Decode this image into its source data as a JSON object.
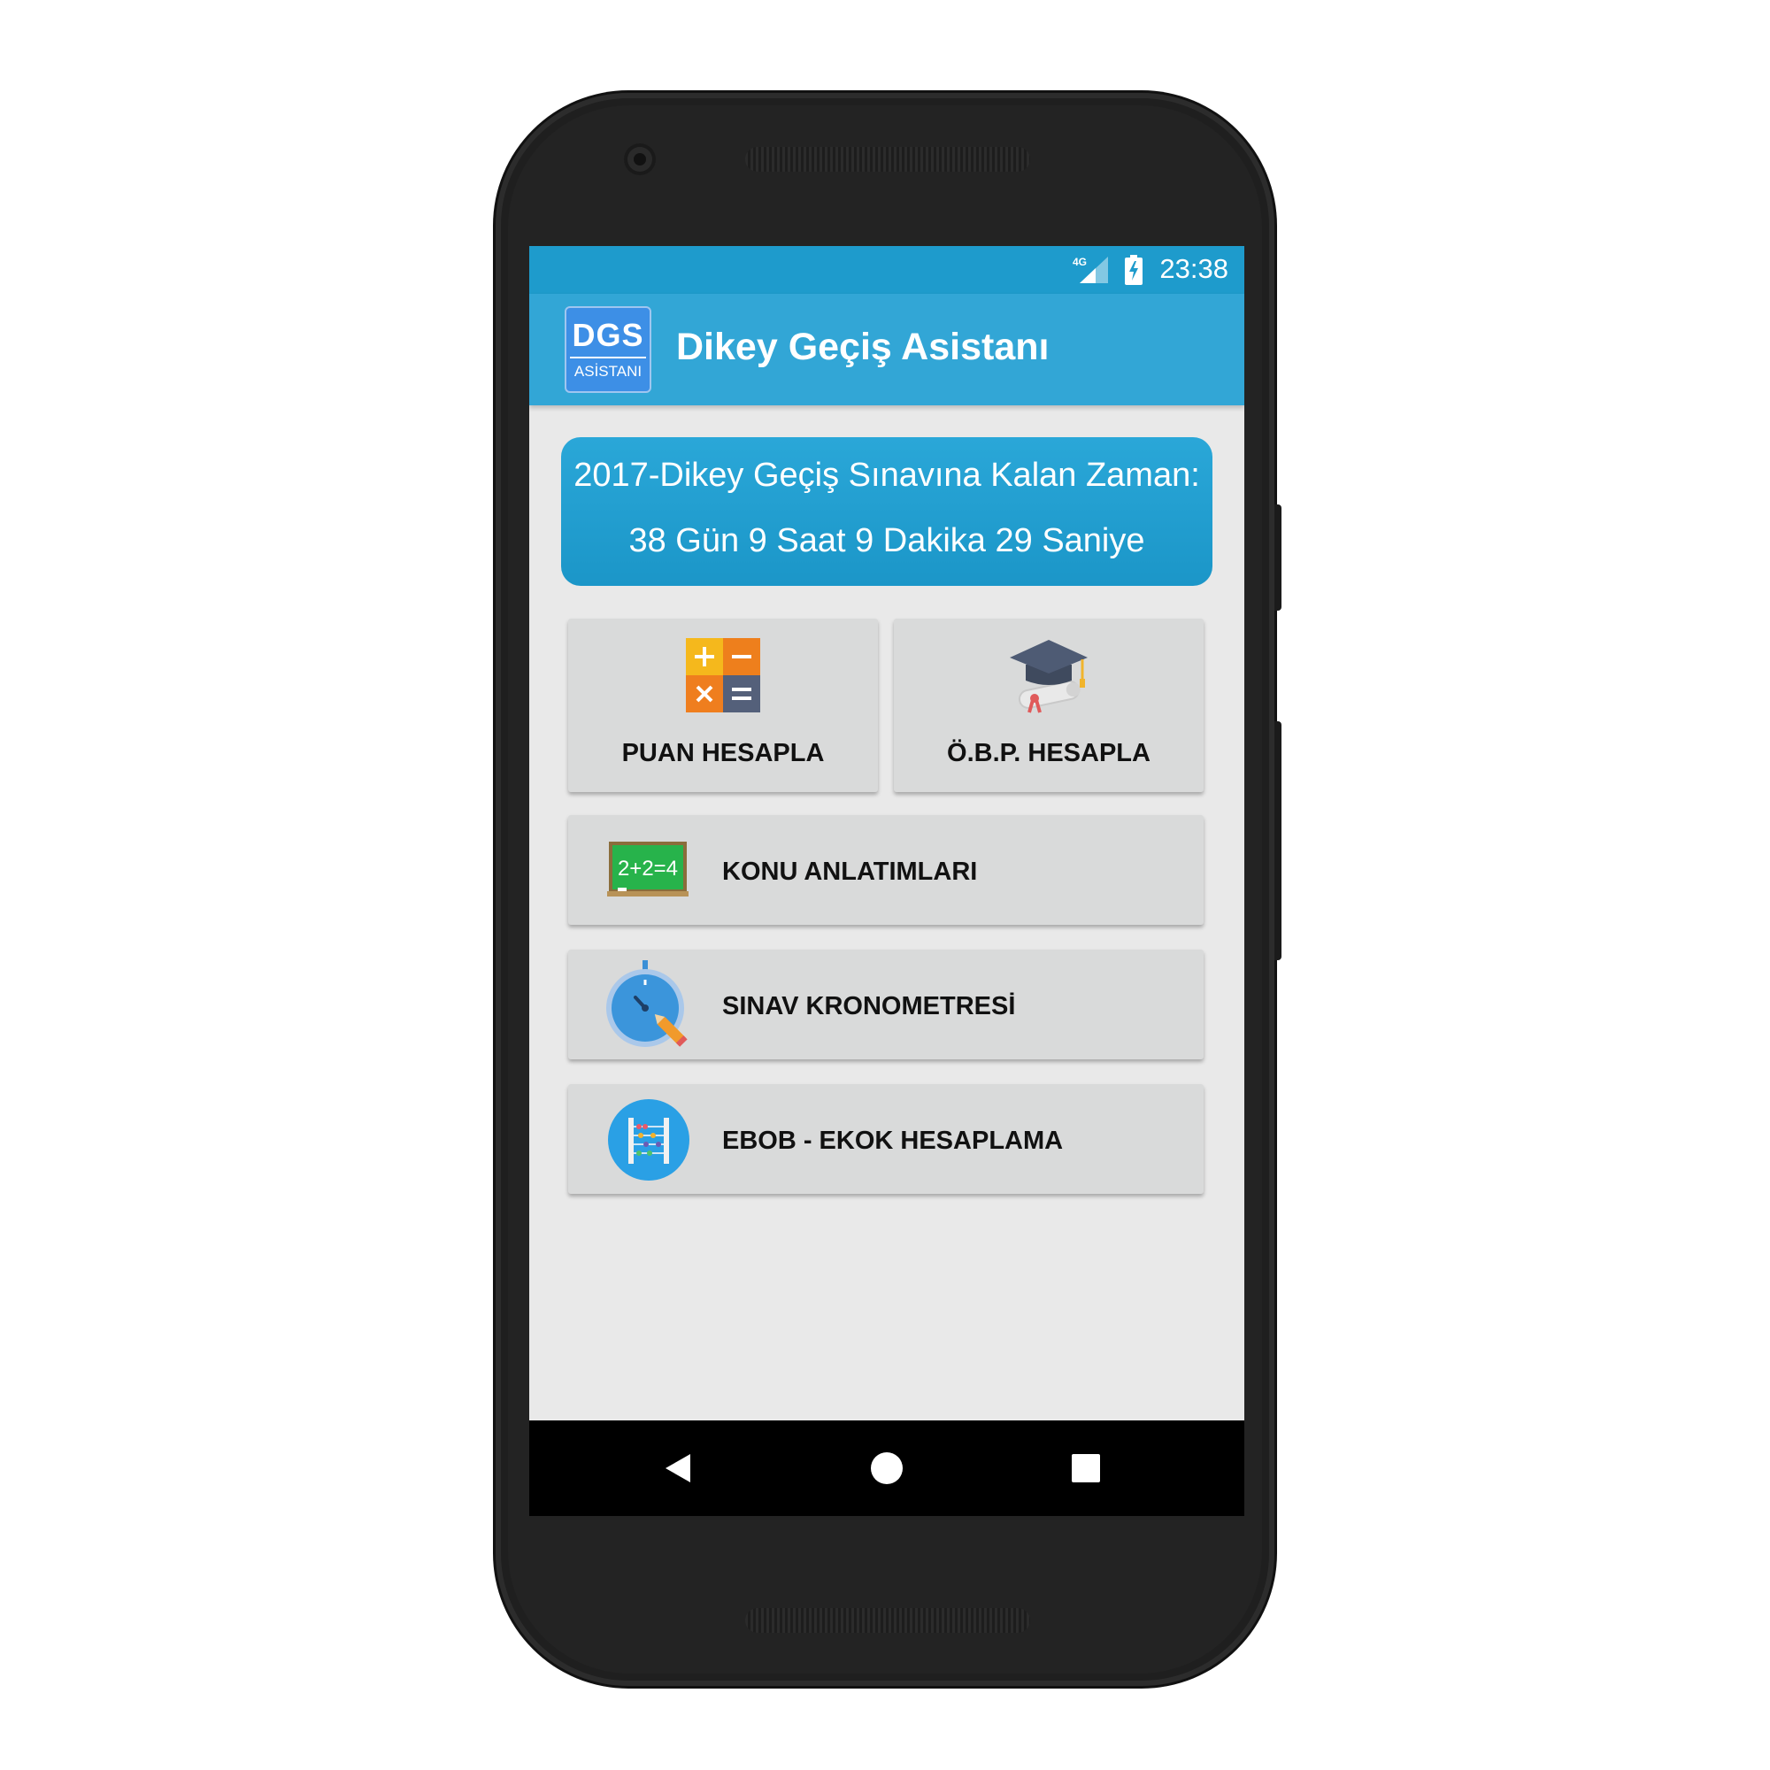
{
  "status_bar": {
    "network": "4G",
    "time": "23:38"
  },
  "app_bar": {
    "logo": {
      "top": "DGS",
      "bottom": "ASİSTANI"
    },
    "title": "Dikey Geçiş Asistanı"
  },
  "countdown": {
    "title": "2017-Dikey Geçiş Sınavına Kalan Zaman:",
    "value": "38 Gün 9 Saat 9 Dakika 29 Saniye"
  },
  "menu": {
    "puan": {
      "label": "PUAN HESAPLA",
      "icon": "calculator-icon"
    },
    "obp": {
      "label": "Ö.B.P. HESAPLA",
      "icon": "graduation-cap-icon"
    },
    "konu": {
      "label": "KONU ANLATIMLARI",
      "icon": "chalkboard-icon",
      "board_text": "2+2=4"
    },
    "kronometre": {
      "label": "SINAV KRONOMETRESİ",
      "icon": "stopwatch-icon"
    },
    "ebob": {
      "label": "EBOB - EKOK HESAPLAMA",
      "icon": "abacus-icon"
    }
  },
  "nav_bar": {
    "back": "back-icon",
    "home": "home-icon",
    "recents": "recents-icon"
  },
  "colors": {
    "status_bar": "#1e9bcc",
    "app_bar": "#32a6d6",
    "card": "#d9dada",
    "background": "#e9e9e9"
  }
}
